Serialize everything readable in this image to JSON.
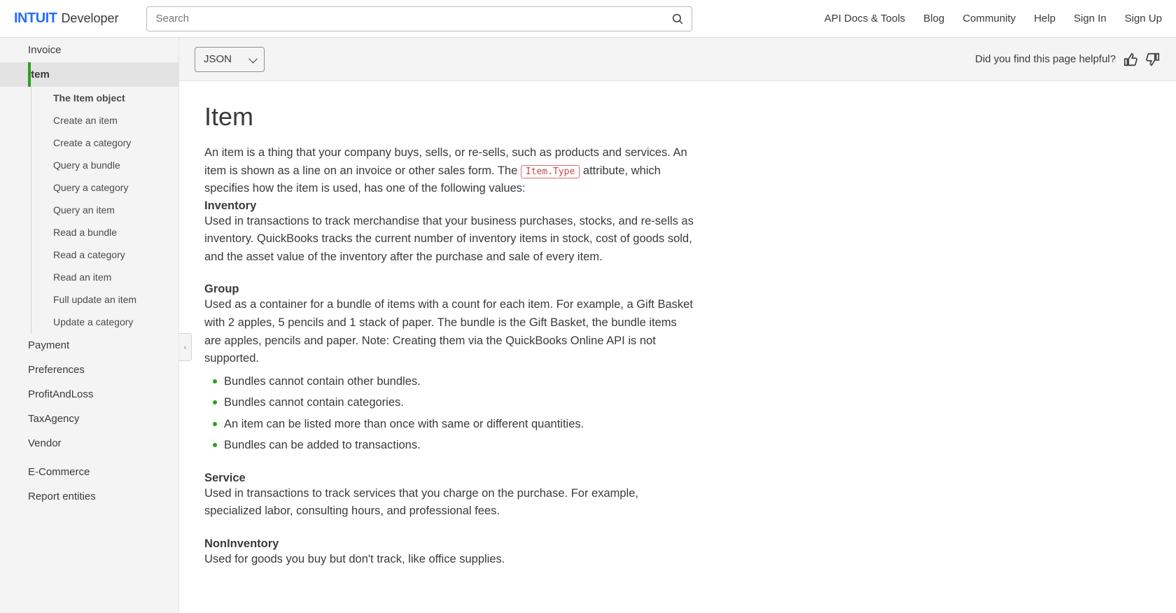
{
  "header": {
    "logo_brand": "INTUIT",
    "logo_sub": "Developer",
    "search_placeholder": "Search",
    "nav": [
      "API Docs & Tools",
      "Blog",
      "Community",
      "Help",
      "Sign In",
      "Sign Up"
    ]
  },
  "format_selected": "JSON",
  "feedback_text": "Did you find this page helpful?",
  "sidebar": {
    "top_before": "Invoice",
    "active": "Item",
    "sub": [
      "The Item object",
      "Create an item",
      "Create a category",
      "Query a bundle",
      "Query a category",
      "Query an item",
      "Read a bundle",
      "Read a category",
      "Read an item",
      "Full update an item",
      "Update a category"
    ],
    "after": [
      "Payment",
      "Preferences",
      "ProfitAndLoss",
      "TaxAgency",
      "Vendor"
    ],
    "sections_after": [
      "E-Commerce",
      "Report entities"
    ]
  },
  "page": {
    "title": "Item",
    "intro_pre": "An item is a thing that your company buys, sells, or re-sells, such as products and services. An item is shown as a line on an invoice or other sales form. The ",
    "intro_code": "Item.Type",
    "intro_post": " attribute, which specifies how the item is used, has one of the following values:",
    "inv_head": "Inventory",
    "inv_body": "Used in transactions to track merchandise that your business purchases, stocks, and re-sells as inventory. QuickBooks tracks the current number of inventory items in stock, cost of goods sold, and the asset value of the inventory after the purchase and sale of every item.",
    "grp_head": "Group",
    "grp_body": "Used as a container for a bundle of items with a count for each item. For example, a Gift Basket with 2 apples, 5 pencils and 1 stack of paper. The bundle is the Gift Basket, the bundle items are apples, pencils and paper. Note: Creating them via the QuickBooks Online API is not supported.",
    "grp_bullets": [
      "Bundles cannot contain other bundles.",
      "Bundles cannot contain categories.",
      "An item can be listed more than once with same or different quantities.",
      "Bundles can be added to transactions."
    ],
    "svc_head": "Service",
    "svc_body": "Used in transactions to track services that you charge on the purchase. For example, specialized labor, consulting hours, and professional fees.",
    "non_head": "NonInventory",
    "non_body": "Used for goods you buy but don't track, like office supplies."
  }
}
